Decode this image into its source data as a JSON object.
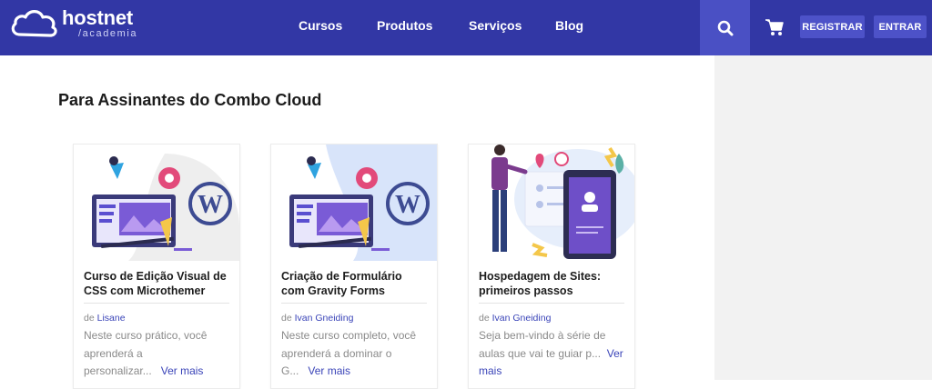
{
  "brand": {
    "name": "hostnet",
    "sub": "/academia"
  },
  "nav": {
    "items": [
      "Cursos",
      "Produtos",
      "Serviços",
      "Blog"
    ]
  },
  "header": {
    "register_label": "REGISTRAR",
    "login_label": "ENTRAR"
  },
  "icons": {
    "search": "search-icon",
    "cart": "cart-icon",
    "logo": "cloud-logo-icon"
  },
  "colors": {
    "topbar": "#3237a5",
    "accent": "#4d52c8",
    "link": "#3a44b8",
    "sidebar": "#f2f2f2"
  },
  "main": {
    "section_title": "Para Assinantes do Combo Cloud"
  },
  "cards": [
    {
      "title": "Curso de Edição Visual de CSS com Microthemer",
      "author_prefix": "de",
      "author": "Lisane",
      "desc_lines": [
        "Neste curso prático, você",
        "aprenderá a",
        "personalizar..."
      ],
      "more": "Ver mais"
    },
    {
      "title": "Criação de Formulário com Gravity Forms",
      "author_prefix": "de",
      "author": "Ivan Gneiding",
      "desc_lines": [
        "Neste curso completo, você",
        "aprenderá a dominar o",
        "G..."
      ],
      "more": "Ver mais"
    },
    {
      "title": "Hospedagem de Sites: primeiros passos",
      "author_prefix": "de",
      "author": "Ivan Gneiding",
      "desc_lines": [
        "Seja bem-vindo à série de",
        "aulas que vai te guiar p..."
      ],
      "more": "Ver mais"
    }
  ]
}
